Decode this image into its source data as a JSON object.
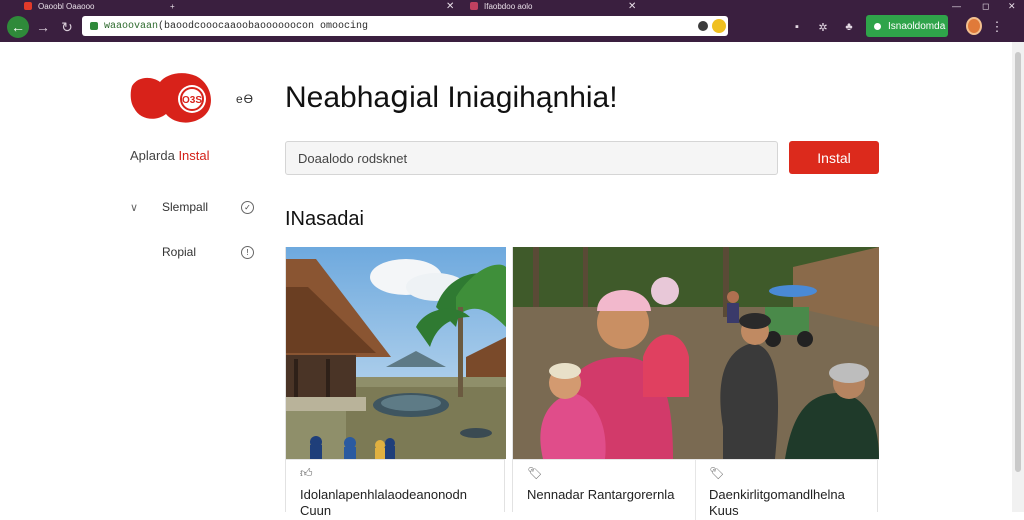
{
  "tabs": [
    {
      "label": "Oaoobl Oaaooo",
      "favicon_color": "#e23a2a"
    },
    {
      "label": "Ifaobdoo aolo",
      "favicon_color": "#c04060"
    }
  ],
  "new_tab_symbol": "+",
  "window_controls": [
    "—",
    "◻",
    "✕"
  ],
  "toolbar": {
    "back_symbol": "←",
    "forward_symbol": "→",
    "reload_symbol": "↻",
    "url_prefix": "waaoovaan",
    "url_rest": "(baoodcooocaaoobaoooooocon omoocing",
    "install_label": "Isnaoldomda",
    "extension_icons": [
      "puzzle-icon",
      "gear-icon",
      "bell-icon"
    ],
    "menu_symbol": "⋮"
  },
  "sidebar": {
    "logo_text": "O3S",
    "logo_suffix": "eƟ",
    "brand_prefix": "Aplarda",
    "brand_highlight": "Instal",
    "items": [
      {
        "label": "Slempall",
        "chevron": "∨",
        "circle": "✓"
      },
      {
        "label": "Ropial",
        "chevron": "",
        "circle": "!"
      }
    ]
  },
  "main": {
    "headline": "Neabhaցial Iniagihąnhia!",
    "search_value": "Doaalodo ɾodsknet",
    "install_button": "Instal",
    "section_title": "INasadai"
  },
  "cards": [
    {
      "title": "Idolanlapenhlalaodeanonodn",
      "title2": "Cuun"
    },
    {
      "title": "Nennadar Rantargorernla",
      "title2": ""
    },
    {
      "title": "Daenkirlitgomandlhelna",
      "title2": "Kuus"
    }
  ],
  "colors": {
    "chrome": "#3a1f3f",
    "accent_red": "#dc2a1c",
    "install_green": "#2fa44a"
  }
}
